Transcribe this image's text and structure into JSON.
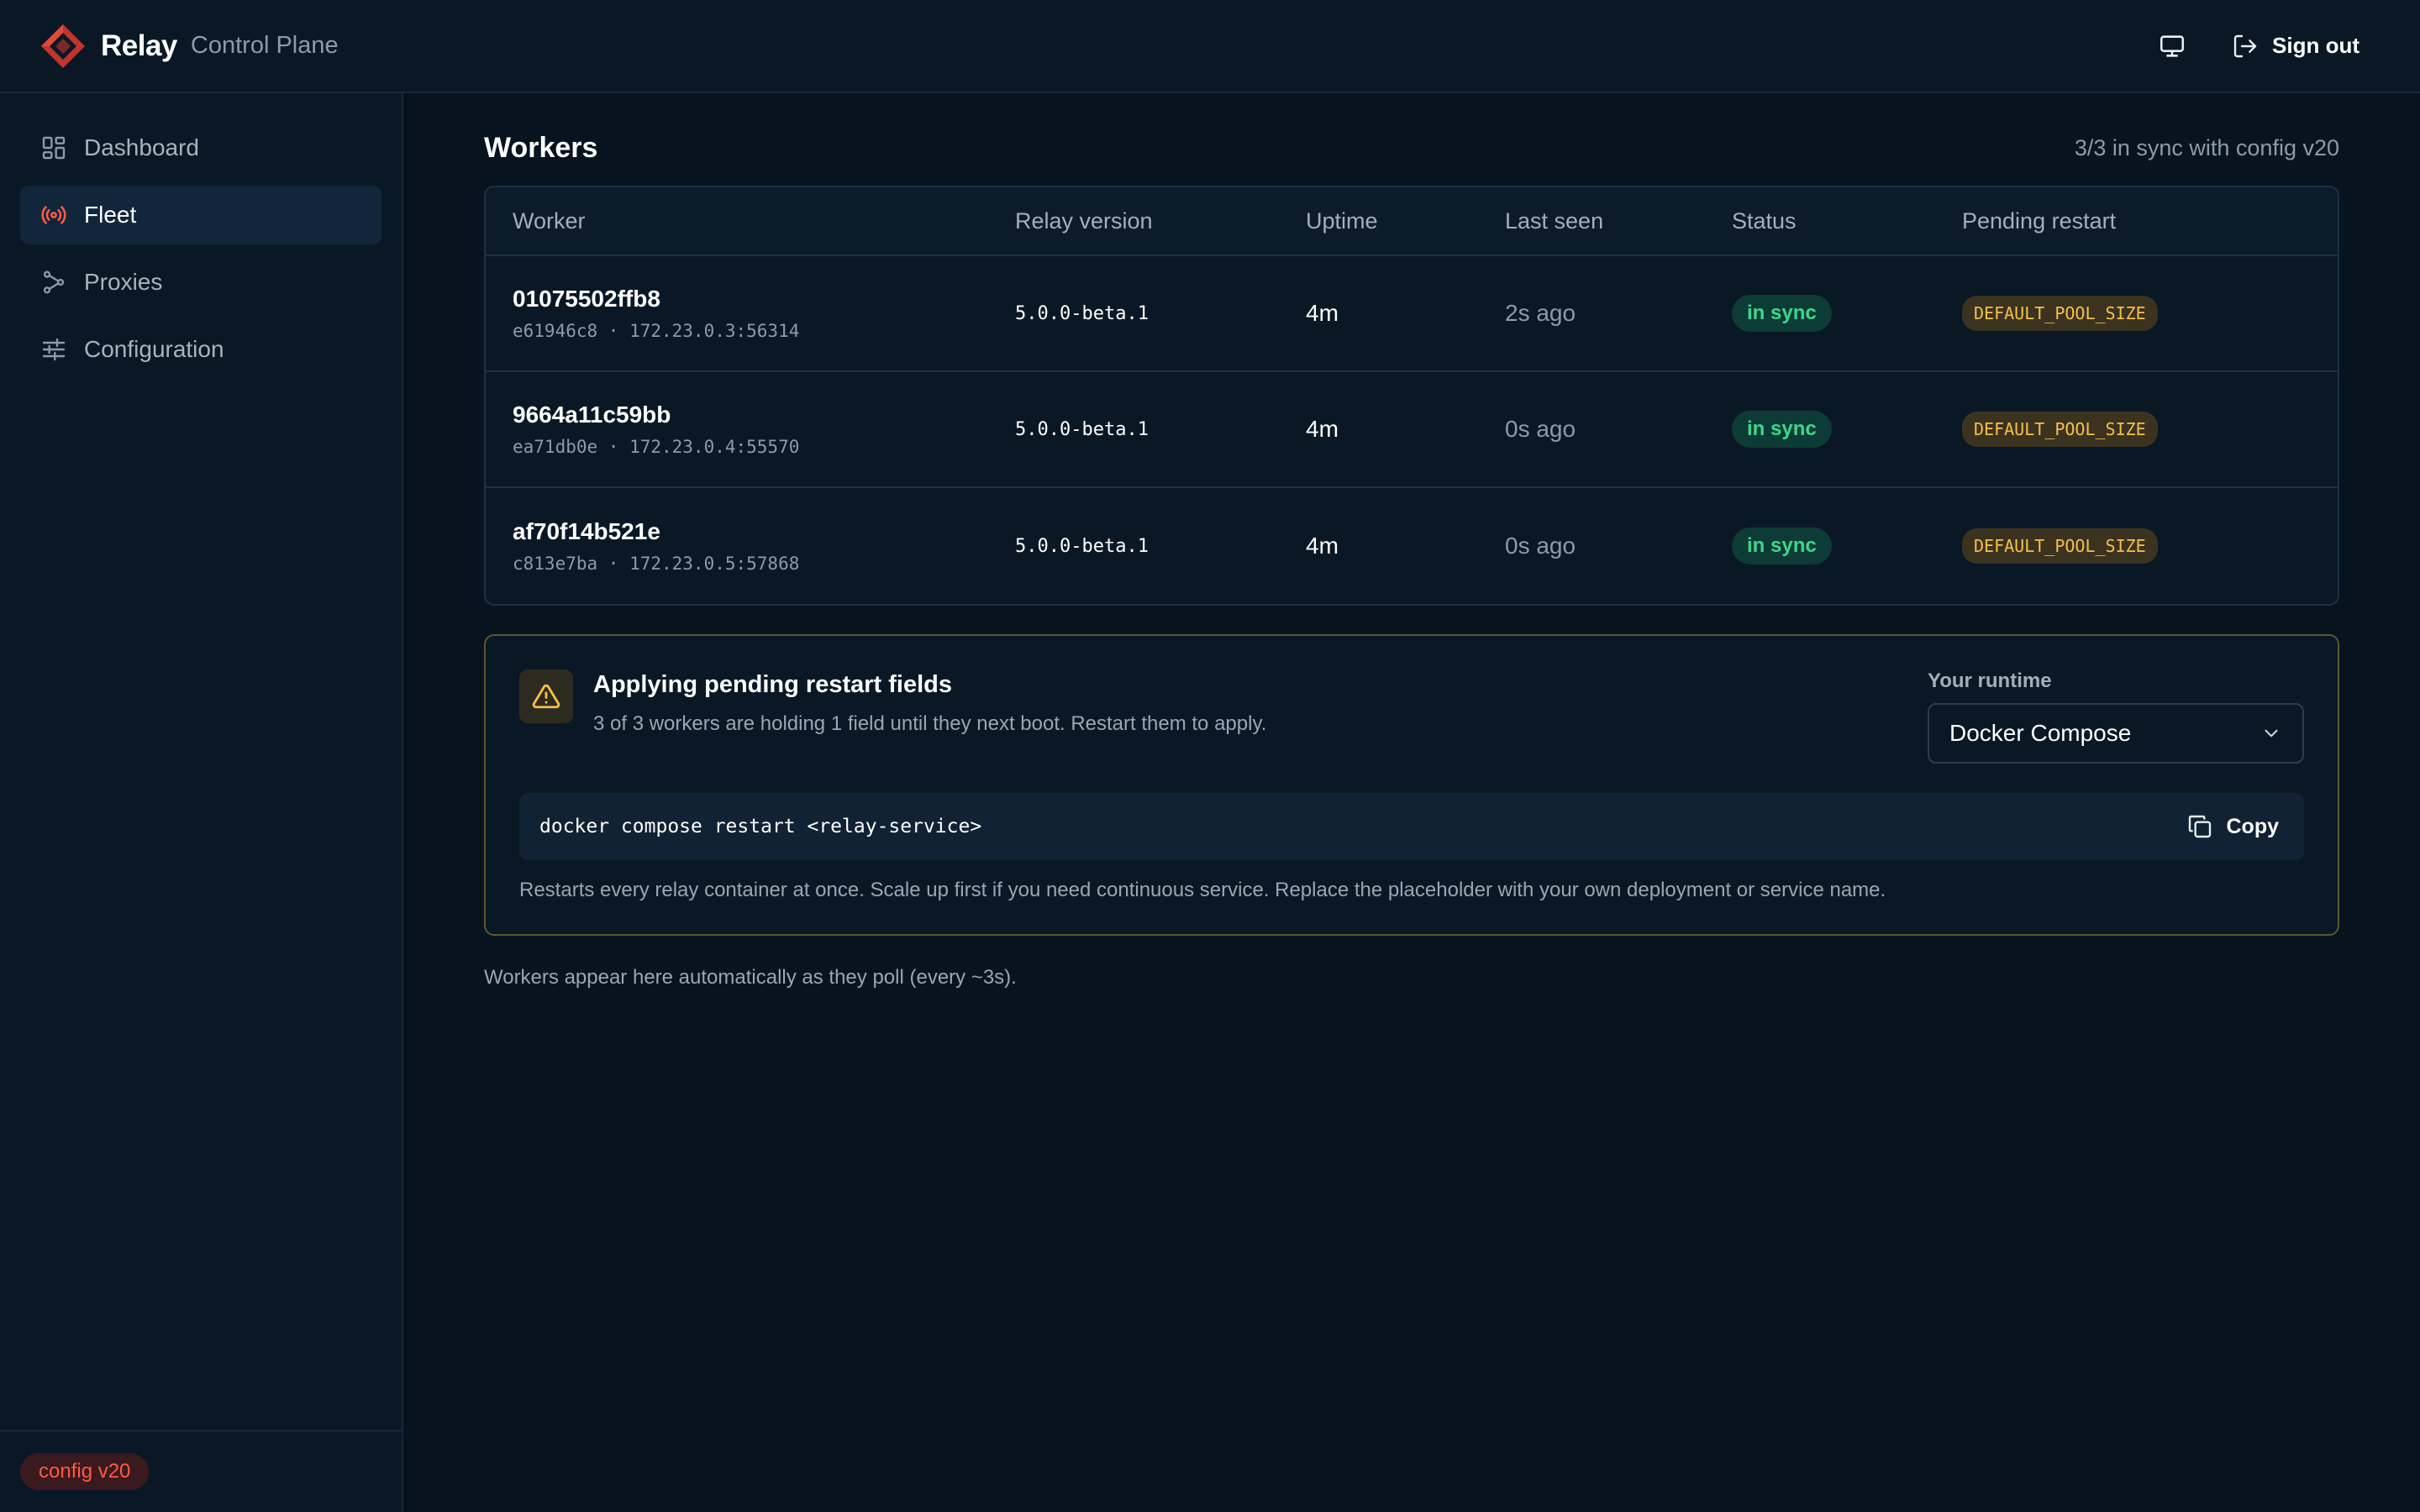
{
  "app": {
    "name": "Relay",
    "subtitle": "Control Plane"
  },
  "header": {
    "signout_label": "Sign out"
  },
  "sidebar": {
    "items": [
      {
        "label": "Dashboard",
        "icon": "dashboard-icon",
        "active": false
      },
      {
        "label": "Fleet",
        "icon": "broadcast-icon",
        "active": true
      },
      {
        "label": "Proxies",
        "icon": "proxies-icon",
        "active": false
      },
      {
        "label": "Configuration",
        "icon": "sliders-icon",
        "active": false
      }
    ],
    "config_badge": "config v20"
  },
  "page": {
    "title": "Workers",
    "sync_summary": "3/3 in sync with config v20"
  },
  "table": {
    "headers": [
      "Worker",
      "Relay version",
      "Uptime",
      "Last seen",
      "Status",
      "Pending restart"
    ],
    "rows": [
      {
        "id": "01075502ffb8",
        "sub": "e61946c8 · 172.23.0.3:56314",
        "version": "5.0.0-beta.1",
        "uptime": "4m",
        "last_seen": "2s ago",
        "status": "in sync",
        "pending": "DEFAULT_POOL_SIZE"
      },
      {
        "id": "9664a11c59bb",
        "sub": "ea71db0e · 172.23.0.4:55570",
        "version": "5.0.0-beta.1",
        "uptime": "4m",
        "last_seen": "0s ago",
        "status": "in sync",
        "pending": "DEFAULT_POOL_SIZE"
      },
      {
        "id": "af70f14b521e",
        "sub": "c813e7ba · 172.23.0.5:57868",
        "version": "5.0.0-beta.1",
        "uptime": "4m",
        "last_seen": "0s ago",
        "status": "in sync",
        "pending": "DEFAULT_POOL_SIZE"
      }
    ]
  },
  "restart": {
    "title": "Applying pending restart fields",
    "description": "3 of 3 workers are holding 1 field until they next boot. Restart them to apply.",
    "runtime_label": "Your runtime",
    "runtime_value": "Docker Compose",
    "command": "docker compose restart <relay-service>",
    "copy_label": "Copy",
    "note": "Restarts every relay container at once. Scale up first if you need continuous service. Replace the placeholder with your own deployment or service name."
  },
  "footer_note": "Workers appear here automatically as they poll (every ~3s).",
  "colors": {
    "background": "#07131f",
    "accent_red": "#ff5a45",
    "status_green": "#3dd68c",
    "warning_amber": "#f5c04a"
  }
}
